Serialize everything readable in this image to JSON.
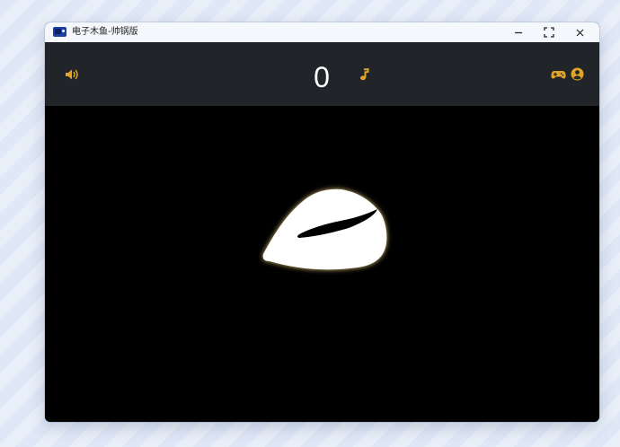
{
  "window": {
    "title": "电子木鱼-帅锅版",
    "app_icon": "app-flag-icon",
    "controls": [
      "minimize-icon",
      "maximize-icon",
      "close-icon"
    ]
  },
  "toolbar": {
    "count": "0",
    "left_icon": "volume-icon",
    "center_icon": "music-note-icon",
    "right_icons": [
      "gamepad-icon",
      "user-circle-icon"
    ]
  },
  "stage": {
    "object": "wooden-fish-icon"
  },
  "colors": {
    "accent": "#e0a526",
    "toolbar_bg": "#212529",
    "stage_bg": "#000000",
    "titlebar_bg": "#f4f7fc",
    "counter_text": "#ffffff"
  }
}
